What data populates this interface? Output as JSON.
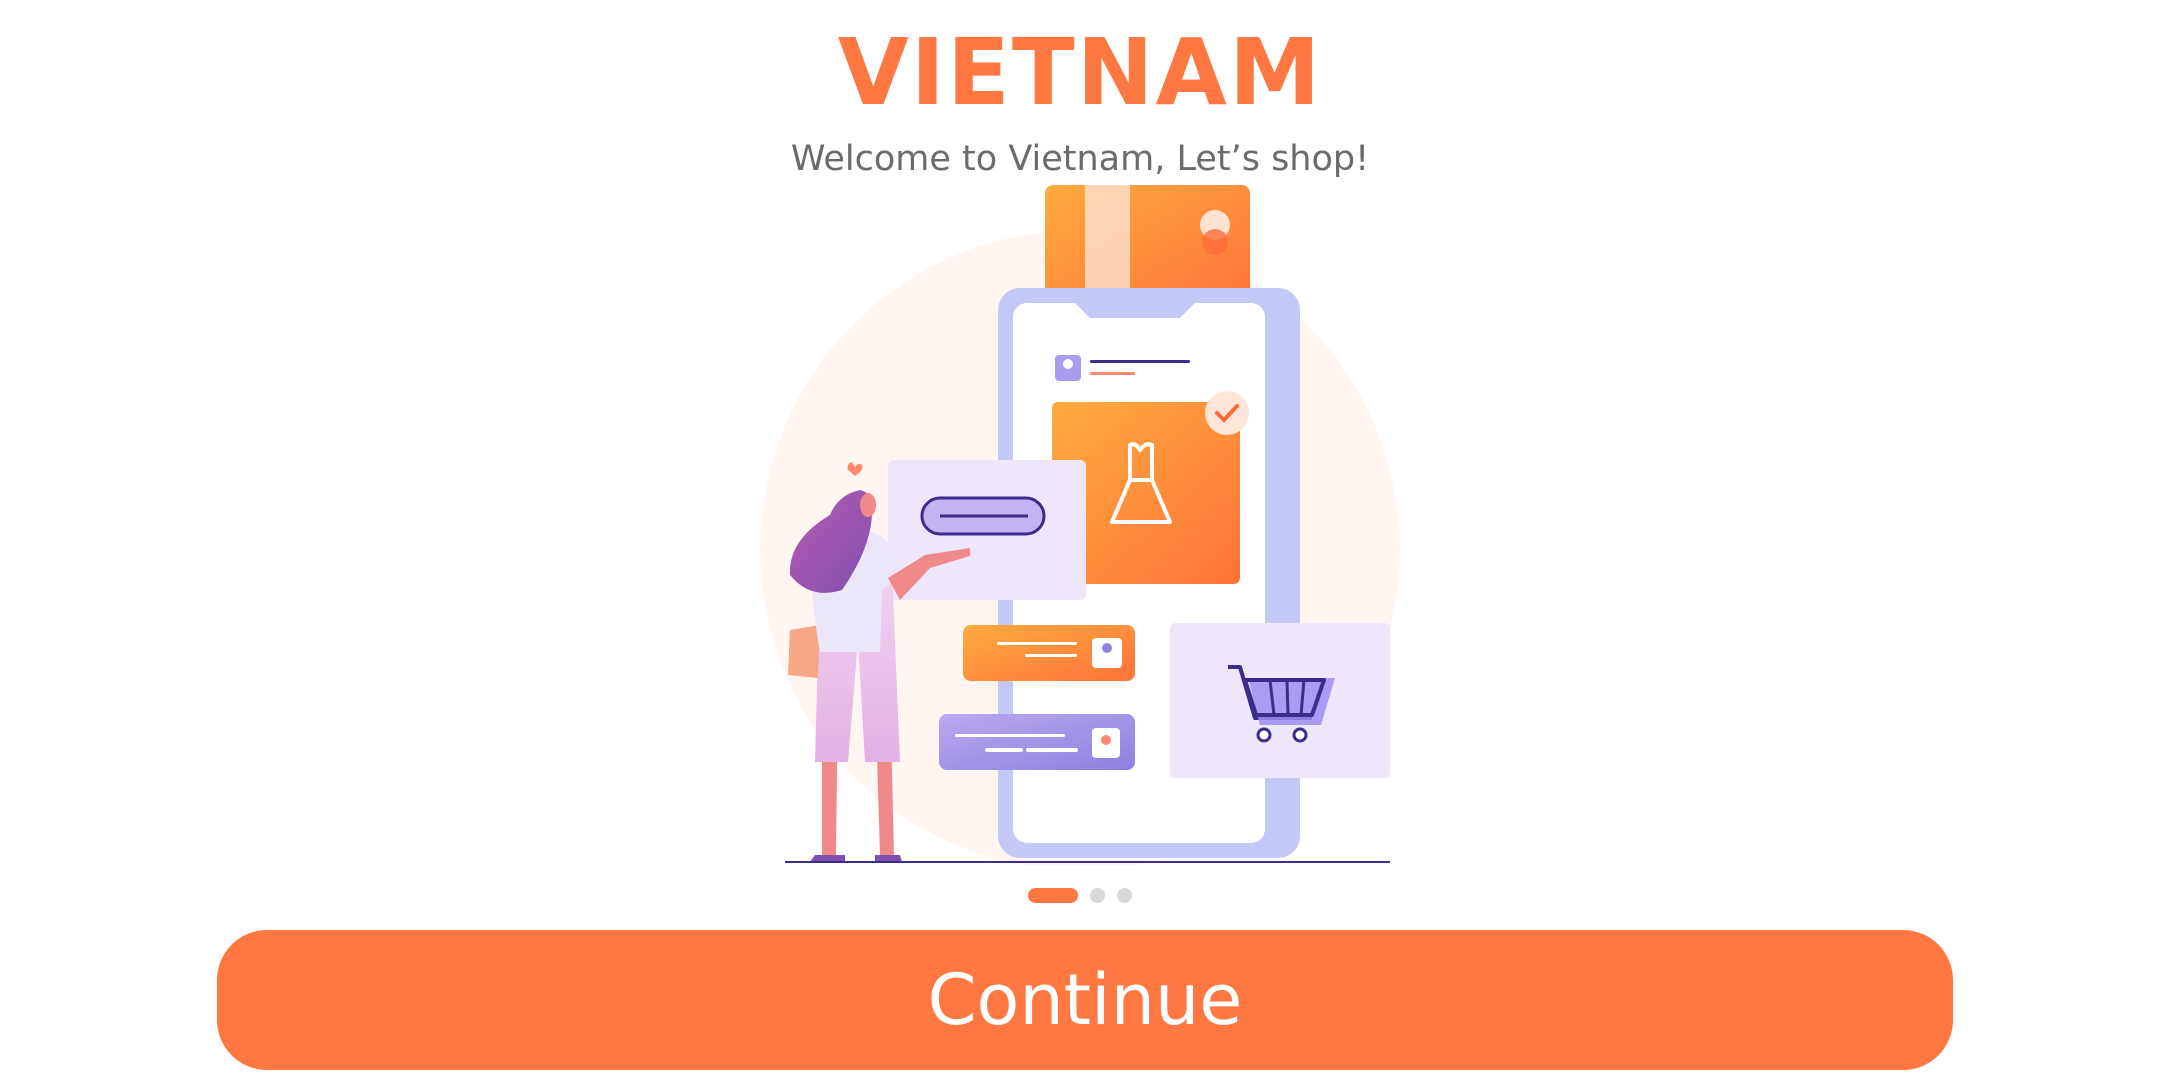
{
  "header": {
    "title": "VIETNAM",
    "subtitle": "Welcome to Vietnam, Let’s shop!"
  },
  "illustration": {
    "icon": "online-shopping-illustration"
  },
  "pagination": {
    "total": 3,
    "active": 1
  },
  "actions": {
    "continue_label": "Continue"
  },
  "colors": {
    "accent": "#ff7741",
    "text_secondary": "#6b6b6b",
    "dot_inactive": "#d8d8d8",
    "purple": "#8f7fe0"
  }
}
